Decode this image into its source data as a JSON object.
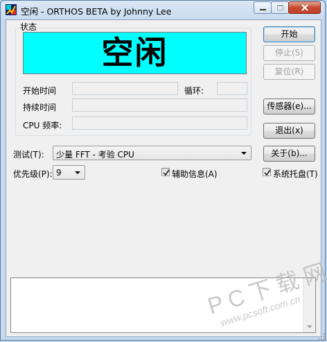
{
  "window": {
    "title": "空闲 - ORTHOS BETA by Johnny Lee",
    "controls": [
      "minimize",
      "maximize",
      "close"
    ]
  },
  "status_group": {
    "label": "状态",
    "status_value": "空闲",
    "status_color": "#00FFFF",
    "start_time_label": "开始时间",
    "start_time_value": "",
    "loop_label": "循环:",
    "loop_value": "",
    "duration_label": "持续时间",
    "duration_value": "",
    "cpu_freq_label": "CPU 频率:",
    "cpu_freq_value": ""
  },
  "buttons": {
    "start": "开始",
    "stop": "停止(S)",
    "reset": "复位(R)",
    "sensors": "传感器(e)...",
    "exit": "退出(x)",
    "about": "关于(b)..."
  },
  "test": {
    "label": "测试(T):",
    "selected": "少量 FFT  - 考验 CPU"
  },
  "priority": {
    "label": "优先级(P):",
    "selected": "9"
  },
  "checkboxes": {
    "aux_info": {
      "label": "辅助信息(A)",
      "checked": true
    },
    "system_tray": {
      "label": "系统托盘(T)",
      "checked": true
    }
  },
  "log": {
    "text": ""
  },
  "watermark": {
    "main": "PC下载网",
    "url": "www.pcsoft.com.cn"
  },
  "icons": [
    "app-icon",
    "minimize-icon",
    "maximize-icon",
    "close-icon",
    "chevron-down-icon",
    "checkmark-icon",
    "resize-grip-icon"
  ]
}
